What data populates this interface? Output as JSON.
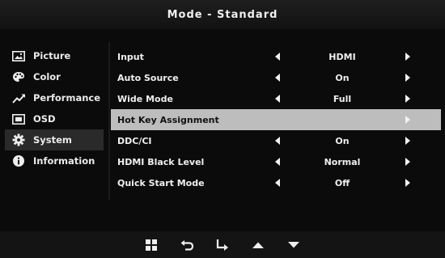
{
  "header": {
    "title": "Mode - Standard"
  },
  "sidebar": {
    "items": [
      {
        "label": "Picture",
        "icon": "picture-icon"
      },
      {
        "label": "Color",
        "icon": "palette-icon"
      },
      {
        "label": "Performance",
        "icon": "performance-icon"
      },
      {
        "label": "OSD",
        "icon": "osd-icon"
      },
      {
        "label": "System",
        "icon": "gear-icon",
        "selected": true
      },
      {
        "label": "Information",
        "icon": "info-icon"
      }
    ]
  },
  "settings": {
    "rows": [
      {
        "label": "Input",
        "value": "HDMI",
        "has_left_arrow": true
      },
      {
        "label": "Auto Source",
        "value": "On",
        "has_left_arrow": true
      },
      {
        "label": "Wide Mode",
        "value": "Full",
        "has_left_arrow": true
      },
      {
        "label": "Hot Key Assignment",
        "value": "",
        "has_left_arrow": false,
        "highlighted": true
      },
      {
        "label": "DDC/CI",
        "value": "On",
        "has_left_arrow": true
      },
      {
        "label": "HDMI Black Level",
        "value": "Normal",
        "has_left_arrow": true
      },
      {
        "label": "Quick Start Mode",
        "value": "Off",
        "has_left_arrow": true
      }
    ]
  },
  "footer": {
    "keys": [
      "menu-grid-icon",
      "back-icon",
      "enter-icon",
      "up-arrow-icon",
      "down-arrow-icon"
    ]
  },
  "colors": {
    "background": "#0b0b0b",
    "highlight": "#bdbdbd",
    "text": "#f2f2f2"
  }
}
